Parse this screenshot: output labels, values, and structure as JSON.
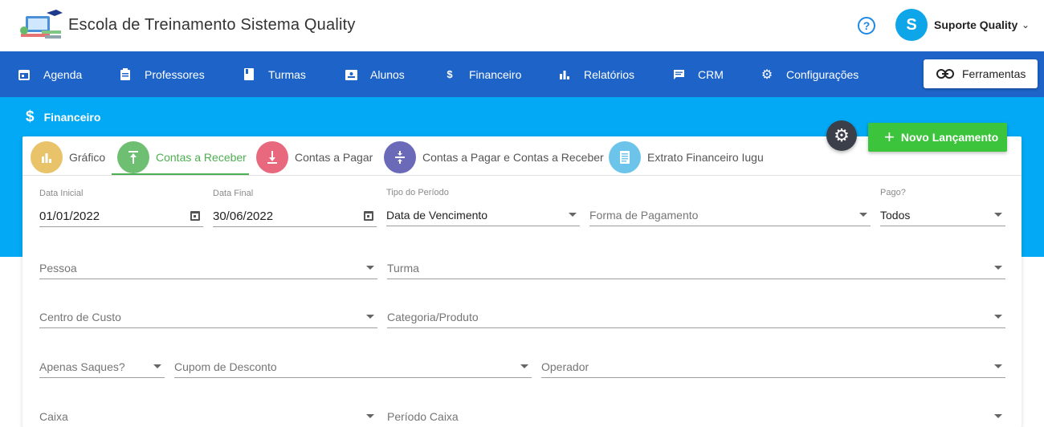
{
  "header": {
    "title": "Escola de Treinamento Sistema Quality",
    "help_icon": "help-circle-icon",
    "user": {
      "initial": "S",
      "name": "Suporte Quality"
    }
  },
  "nav": [
    {
      "label": "Agenda",
      "icon": "calendar-icon"
    },
    {
      "label": "Professores",
      "icon": "clipboard-icon"
    },
    {
      "label": "Turmas",
      "icon": "book-icon"
    },
    {
      "label": "Alunos",
      "icon": "id-card-icon"
    },
    {
      "label": "Financeiro",
      "icon": "dollar-icon"
    },
    {
      "label": "Relatórios",
      "icon": "bar-chart-icon"
    },
    {
      "label": "CRM",
      "icon": "message-icon"
    },
    {
      "label": "Configurações",
      "icon": "gear-icon"
    }
  ],
  "tools_button": "Ferramentas",
  "section_title": "Financeiro",
  "new_button": "Novo Lançamento",
  "tabs": [
    {
      "label": "Gráfico",
      "color": "#e8c36a",
      "active": false
    },
    {
      "label": "Contas a Receber",
      "color": "#6fbf73",
      "active": true
    },
    {
      "label": "Contas a Pagar",
      "color": "#e8697d",
      "active": false
    },
    {
      "label": "Contas a Pagar e Contas a Receber",
      "color": "#6a6ab8",
      "active": false
    },
    {
      "label": "Extrato Financeiro Iugu",
      "color": "#6cc4ea",
      "active": false
    }
  ],
  "filters": {
    "data_inicial": {
      "label": "Data Inicial",
      "value": "01/01/2022"
    },
    "data_final": {
      "label": "Data Final",
      "value": "30/06/2022"
    },
    "tipo_periodo": {
      "label": "Tipo do Período",
      "value": "Data de Vencimento"
    },
    "forma_pagamento": {
      "placeholder": "Forma de Pagamento"
    },
    "pago": {
      "label": "Pago?",
      "value": "Todos"
    },
    "pessoa": {
      "placeholder": "Pessoa"
    },
    "turma": {
      "placeholder": "Turma"
    },
    "centro_custo": {
      "placeholder": "Centro de Custo"
    },
    "categoria": {
      "placeholder": "Categoria/Produto"
    },
    "apenas_saques": {
      "placeholder": "Apenas Saques?"
    },
    "cupom": {
      "placeholder": "Cupom de Desconto"
    },
    "operador": {
      "placeholder": "Operador"
    },
    "caixa": {
      "placeholder": "Caixa"
    },
    "periodo_caixa": {
      "placeholder": "Período Caixa"
    }
  },
  "colors": {
    "nav_bg": "#1e63c7",
    "hero_bg": "#03a9f4",
    "accent_green": "#4caf50",
    "new_button_bg": "#3cc43c"
  }
}
